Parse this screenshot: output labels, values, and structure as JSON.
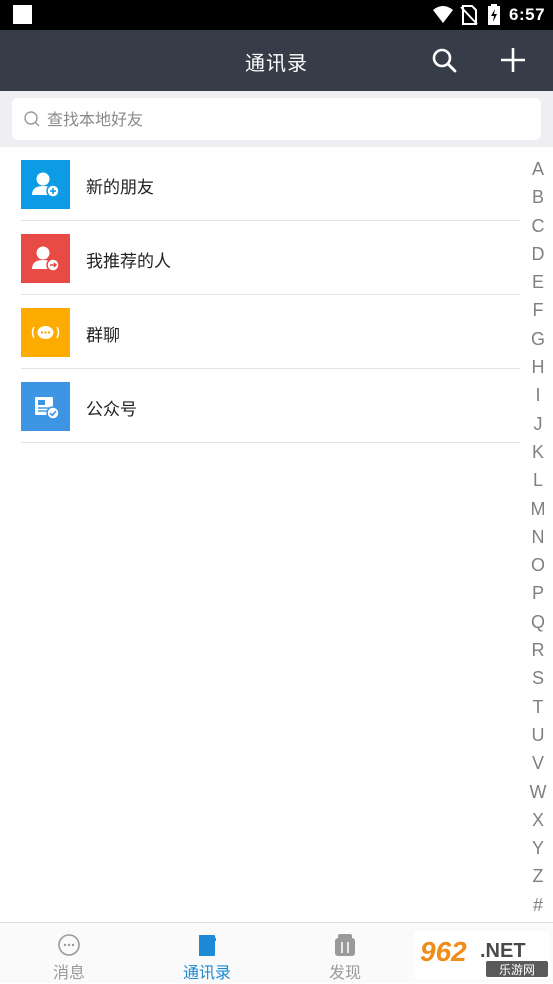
{
  "status_bar": {
    "time": "6:57"
  },
  "header": {
    "title": "通讯录"
  },
  "search": {
    "placeholder": "查找本地好友"
  },
  "entries": [
    {
      "label": "新的朋友",
      "color": "#0e9be6",
      "icon": "new-friend-icon"
    },
    {
      "label": "我推荐的人",
      "color": "#e84a45",
      "icon": "recommended-icon"
    },
    {
      "label": "群聊",
      "color": "#fdab00",
      "icon": "group-chat-icon"
    },
    {
      "label": "公众号",
      "color": "#3d95e3",
      "icon": "official-account-icon"
    }
  ],
  "index_letters": [
    "A",
    "B",
    "C",
    "D",
    "E",
    "F",
    "G",
    "H",
    "I",
    "J",
    "K",
    "L",
    "M",
    "N",
    "O",
    "P",
    "Q",
    "R",
    "S",
    "T",
    "U",
    "V",
    "W",
    "X",
    "Y",
    "Z",
    "#"
  ],
  "tabs": [
    {
      "label": "消息",
      "icon": "message-icon",
      "active": false
    },
    {
      "label": "通讯录",
      "icon": "contacts-icon",
      "active": true
    },
    {
      "label": "发现",
      "icon": "discover-icon",
      "active": false
    }
  ],
  "watermark": {
    "brand": "962",
    "suffix": ".NET",
    "caption": "乐游网"
  },
  "colors": {
    "title_bar": "#363c48",
    "accent": "#1e8ad6"
  }
}
